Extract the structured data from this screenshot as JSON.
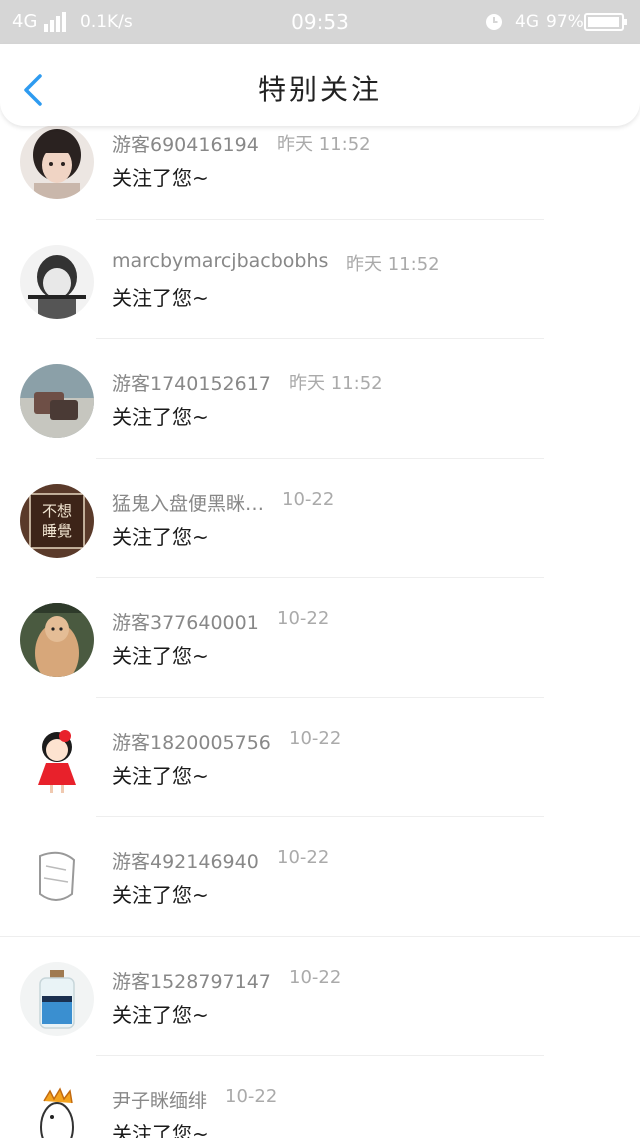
{
  "status_bar": {
    "network": "4G",
    "speed": "0.1K/s",
    "time": "09:53",
    "network2": "4G",
    "battery_percent": "97%",
    "battery_level": 0.97,
    "signal_icon": "signal-bars-icon",
    "alarm_icon": "alarm-clock-icon",
    "battery_icon": "battery-icon"
  },
  "header": {
    "title": "特别关注",
    "back_icon": "chevron-left-icon"
  },
  "colors": {
    "accent": "#2e9bf0",
    "status_bar_bg": "#d6d6d6"
  },
  "followers": [
    {
      "name": "游客690416194",
      "time": "昨天 11:52",
      "message": "关注了您~"
    },
    {
      "name": "marcbymarcjbacbobhs",
      "time": "昨天 11:52",
      "message": "关注了您~"
    },
    {
      "name": "游客1740152617",
      "time": "昨天 11:52",
      "message": "关注了您~"
    },
    {
      "name": "猛鬼入盘便黑眯…",
      "time": "10-22",
      "message": "关注了您~",
      "avatar_text": [
        "不想",
        "睡覺"
      ]
    },
    {
      "name": "游客377640001",
      "time": "10-22",
      "message": "关注了您~"
    },
    {
      "name": "游客1820005756",
      "time": "10-22",
      "message": "关注了您~"
    },
    {
      "name": "游客492146940",
      "time": "10-22",
      "message": "关注了您~"
    },
    {
      "name": "游客1528797147",
      "time": "10-22",
      "message": "关注了您~"
    },
    {
      "name": "尹子眯缅绯",
      "time": "10-22",
      "message": "关注了您~"
    }
  ]
}
